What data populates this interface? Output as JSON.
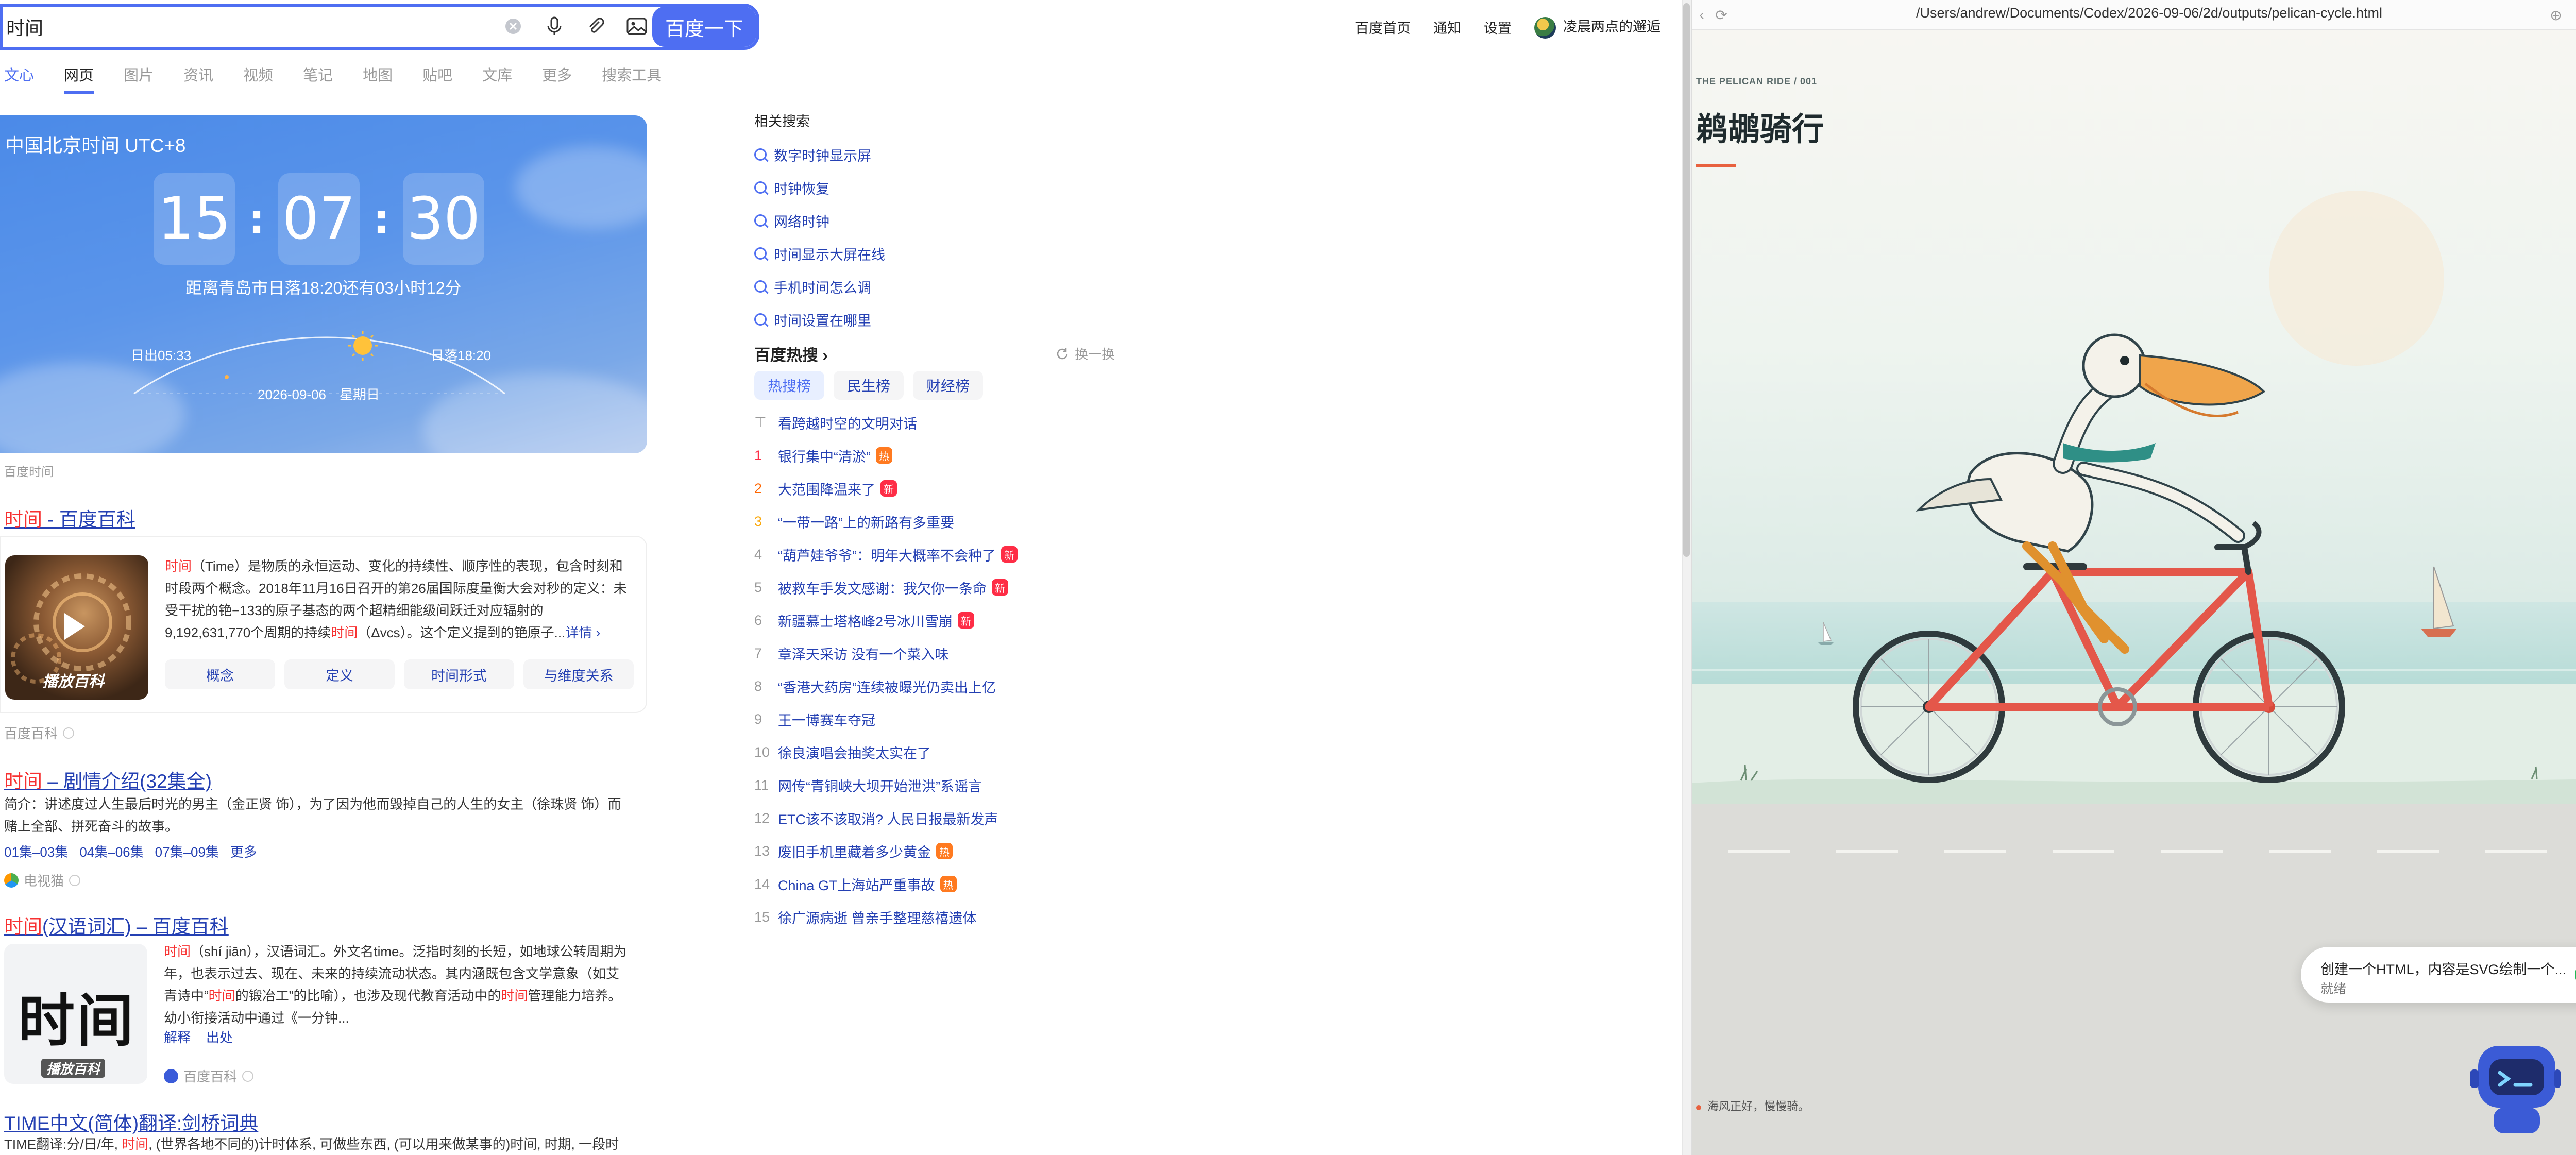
{
  "search": {
    "query": "时间",
    "button_label": "百度一下"
  },
  "top_nav": {
    "items": [
      "百度首页",
      "通知",
      "设置"
    ],
    "username": "凌晨两点的邂逅"
  },
  "tabs": [
    "文心",
    "网页",
    "图片",
    "资讯",
    "视频",
    "笔记",
    "地图",
    "贴吧",
    "文库",
    "更多",
    "搜索工具"
  ],
  "clock": {
    "title": "中国北京时间 UTC+8",
    "hours": "15",
    "minutes": "07",
    "seconds": "30",
    "sunset_note": "距离青岛市日落18:20还有03小时12分",
    "sunrise": "日出05:33",
    "sunset": "日落18:20",
    "date": "2026-09-06　星期日",
    "source": "百度时间"
  },
  "result1": {
    "title_hl": "时间",
    "title_rest": " - 百度百科",
    "text_hl": "时间",
    "text_a": "（Time）是物质的永恒运动、变化的持续性、顺序性的表现，包含时刻和时段两个概念。2018年11月16日召开的第26届国际度量衡大会对秒的定义：未受干扰的铯−133的原子基态的两个超精细能级间跃迁对应辐射的9,192,631,770个周期的持续",
    "text_hl2": "时间",
    "text_b": "（Δvcs）。这个定义提到的铯原子...",
    "more_label": "详情 ›",
    "thumb_badge": "播放百科",
    "chips": [
      "概念",
      "定义",
      "时间形式",
      "与维度关系"
    ],
    "source": "百度百科"
  },
  "result2": {
    "title_hl": "时间",
    "title_rest": " – 剧情介绍(32集全)",
    "snippet": "简介：讲述度过人生最后时光的男主（金正贤 饰），为了因为他而毁掉自己的人生的女主（徐珠贤 饰）而赌上全部、拼死奋斗的故事。",
    "episodes": [
      "01集–03集",
      "04集–06集",
      "07集–09集",
      "更多"
    ],
    "source": "电视猫"
  },
  "result3": {
    "title_hl": "时间",
    "title_rest": "(汉语词汇) – 百度百科",
    "text_hl": "时间",
    "text_a": "（shí jiān），汉语词汇。外文名time。泛指时刻的长短，如地球公转周期为年，也表示过去、现在、未来的持续流动状态。其内涵既包含文学意象（如艾青诗中“",
    "text_hl2": "时间",
    "text_b": "的锻冶工”的比喻），也涉及现代教育活动中的",
    "text_hl3": "时间",
    "text_c": "管理能力培养。幼小衔接活动中通过《一分钟...",
    "thumb_word": "时间",
    "thumb_badge": "播放百科",
    "links": [
      "解释",
      "出处"
    ],
    "source": "百度百科"
  },
  "result4": {
    "title": "TIME中文(简体)翻译:剑桥词典",
    "snippet_a": "TIME翻译:分/日/年, ",
    "snippet_hl": "时间",
    "snippet_b": ", (世界各地不同的)计时体系, 可做些东西, (可以用来做某事的)时间, 时期, 一段时"
  },
  "related": {
    "heading": "相关搜索",
    "items": [
      "数字时钟显示屏",
      "时钟恢复",
      "网络时钟",
      "时间显示大屏在线",
      "手机时间怎么调",
      "时间设置在哪里"
    ]
  },
  "hot": {
    "title": "百度热搜",
    "refresh": "换一换",
    "tabs": [
      "热搜榜",
      "民生榜",
      "财经榜"
    ],
    "pinned": "看跨越时空的文明对话",
    "items": [
      {
        "rank": "1",
        "text": "银行集中“清淤”",
        "badge": "热",
        "badge_color": "#ff7a20"
      },
      {
        "rank": "2",
        "text": "大范围降温来了",
        "badge": "新",
        "badge_color": "#fe2d46"
      },
      {
        "rank": "3",
        "text": "“一带一路”上的新路有多重要",
        "badge": "",
        "badge_color": ""
      },
      {
        "rank": "4",
        "text": "“葫芦娃爷爷”：明年大概率不会种了",
        "badge": "新",
        "badge_color": "#fe2d46"
      },
      {
        "rank": "5",
        "text": "被救车手发文感谢：我欠你一条命",
        "badge": "新",
        "badge_color": "#fe2d46"
      },
      {
        "rank": "6",
        "text": "新疆慕士塔格峰2号冰川雪崩",
        "badge": "新",
        "badge_color": "#fe2d46"
      },
      {
        "rank": "7",
        "text": "章泽天采访 没有一个菜入味",
        "badge": "",
        "badge_color": ""
      },
      {
        "rank": "8",
        "text": "“香港大药房”连续被曝光仍卖出上亿",
        "badge": "",
        "badge_color": ""
      },
      {
        "rank": "9",
        "text": "王一博赛车夺冠",
        "badge": "",
        "badge_color": ""
      },
      {
        "rank": "10",
        "text": "徐良演唱会抽奖太实在了",
        "badge": "",
        "badge_color": ""
      },
      {
        "rank": "11",
        "text": "网传“青铜峡大坝开始泄洪”系谣言",
        "badge": "",
        "badge_color": ""
      },
      {
        "rank": "12",
        "text": "ETC该不该取消? 人民日报最新发声",
        "badge": "",
        "badge_color": ""
      },
      {
        "rank": "13",
        "text": "废旧手机里藏着多少黄金",
        "badge": "热",
        "badge_color": "#ff7a20"
      },
      {
        "rank": "14",
        "text": "China GT上海站严重事故",
        "badge": "热",
        "badge_color": "#ff7a20"
      },
      {
        "rank": "15",
        "text": "徐广源病逝 曾亲手整理慈禧遗体",
        "badge": "",
        "badge_color": ""
      }
    ]
  },
  "preview": {
    "path": "/Users/andrew/Documents/Codex/2026-09-06/2d/outputs/pelican-cycle.html",
    "kicker": "THE PELICAN RIDE / 001",
    "title": "鹈鹕骑行",
    "caption": "海风正好，慢慢骑。"
  },
  "toast": {
    "title": "创建一个HTML，内容是SVG绘制一个...",
    "status": "就绪"
  },
  "colors": {
    "accent": "#4e6ef2",
    "link": "#2440b3",
    "highlight": "#f73131",
    "toast_check": "#1fb954"
  }
}
